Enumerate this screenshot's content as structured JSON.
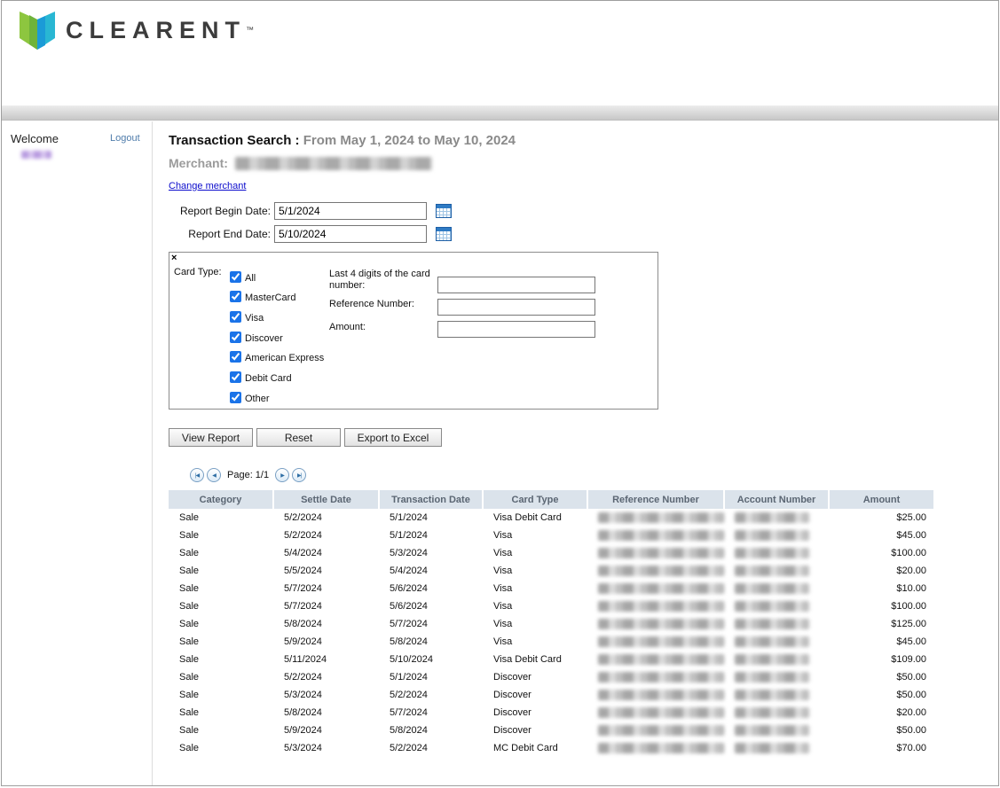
{
  "header": {
    "brand": "CLEARENT",
    "tm": "™"
  },
  "sidebar": {
    "welcome": "Welcome",
    "logout": "Logout"
  },
  "main": {
    "title": "Transaction Search :",
    "title_range": "From May 1, 2024 to May 10, 2024",
    "merchant_label": "Merchant:",
    "change_merchant": "Change merchant",
    "form": {
      "begin_label": "Report Begin Date:",
      "begin_value": "5/1/2024",
      "end_label": "Report End Date:",
      "end_value": "5/10/2024"
    },
    "filters": {
      "close_glyph": "×",
      "card_type_label": "Card Type:",
      "card_types": [
        "All",
        "MasterCard",
        "Visa",
        "Discover",
        "American Express",
        "Debit Card",
        "Other"
      ],
      "last4_label": "Last 4 digits of the card number:",
      "reference_label": "Reference Number:",
      "amount_label": "Amount:"
    },
    "buttons": {
      "view_report": "View Report",
      "reset": "Reset",
      "export": "Export to Excel"
    },
    "pagination": {
      "first_glyph": "|◀",
      "prev_glyph": "◀",
      "label": "Page: 1/1",
      "next_glyph": "▶",
      "last_glyph": "▶|"
    },
    "table": {
      "headers": [
        "Category",
        "Settle Date",
        "Transaction Date",
        "Card Type",
        "Reference Number",
        "Account Number",
        "Amount"
      ],
      "rows": [
        {
          "category": "Sale",
          "settle_date": "5/2/2024",
          "transaction_date": "5/1/2024",
          "card_type": "Visa Debit Card",
          "amount": "$25.00"
        },
        {
          "category": "Sale",
          "settle_date": "5/2/2024",
          "transaction_date": "5/1/2024",
          "card_type": "Visa",
          "amount": "$45.00"
        },
        {
          "category": "Sale",
          "settle_date": "5/4/2024",
          "transaction_date": "5/3/2024",
          "card_type": "Visa",
          "amount": "$100.00"
        },
        {
          "category": "Sale",
          "settle_date": "5/5/2024",
          "transaction_date": "5/4/2024",
          "card_type": "Visa",
          "amount": "$20.00"
        },
        {
          "category": "Sale",
          "settle_date": "5/7/2024",
          "transaction_date": "5/6/2024",
          "card_type": "Visa",
          "amount": "$10.00"
        },
        {
          "category": "Sale",
          "settle_date": "5/7/2024",
          "transaction_date": "5/6/2024",
          "card_type": "Visa",
          "amount": "$100.00"
        },
        {
          "category": "Sale",
          "settle_date": "5/8/2024",
          "transaction_date": "5/7/2024",
          "card_type": "Visa",
          "amount": "$125.00"
        },
        {
          "category": "Sale",
          "settle_date": "5/9/2024",
          "transaction_date": "5/8/2024",
          "card_type": "Visa",
          "amount": "$45.00"
        },
        {
          "category": "Sale",
          "settle_date": "5/11/2024",
          "transaction_date": "5/10/2024",
          "card_type": "Visa Debit Card",
          "amount": "$109.00"
        },
        {
          "category": "Sale",
          "settle_date": "5/2/2024",
          "transaction_date": "5/1/2024",
          "card_type": "Discover",
          "amount": "$50.00"
        },
        {
          "category": "Sale",
          "settle_date": "5/3/2024",
          "transaction_date": "5/2/2024",
          "card_type": "Discover",
          "amount": "$50.00"
        },
        {
          "category": "Sale",
          "settle_date": "5/8/2024",
          "transaction_date": "5/7/2024",
          "card_type": "Discover",
          "amount": "$20.00"
        },
        {
          "category": "Sale",
          "settle_date": "5/9/2024",
          "transaction_date": "5/8/2024",
          "card_type": "Discover",
          "amount": "$50.00"
        },
        {
          "category": "Sale",
          "settle_date": "5/3/2024",
          "transaction_date": "5/2/2024",
          "card_type": "MC Debit Card",
          "amount": "$70.00"
        }
      ]
    }
  },
  "colors": {
    "brand_green": "#8dc63f",
    "brand_blue": "#29b7d3",
    "table_header_bg": "#dbe3eb",
    "link_blue": "#0b0bcc"
  }
}
